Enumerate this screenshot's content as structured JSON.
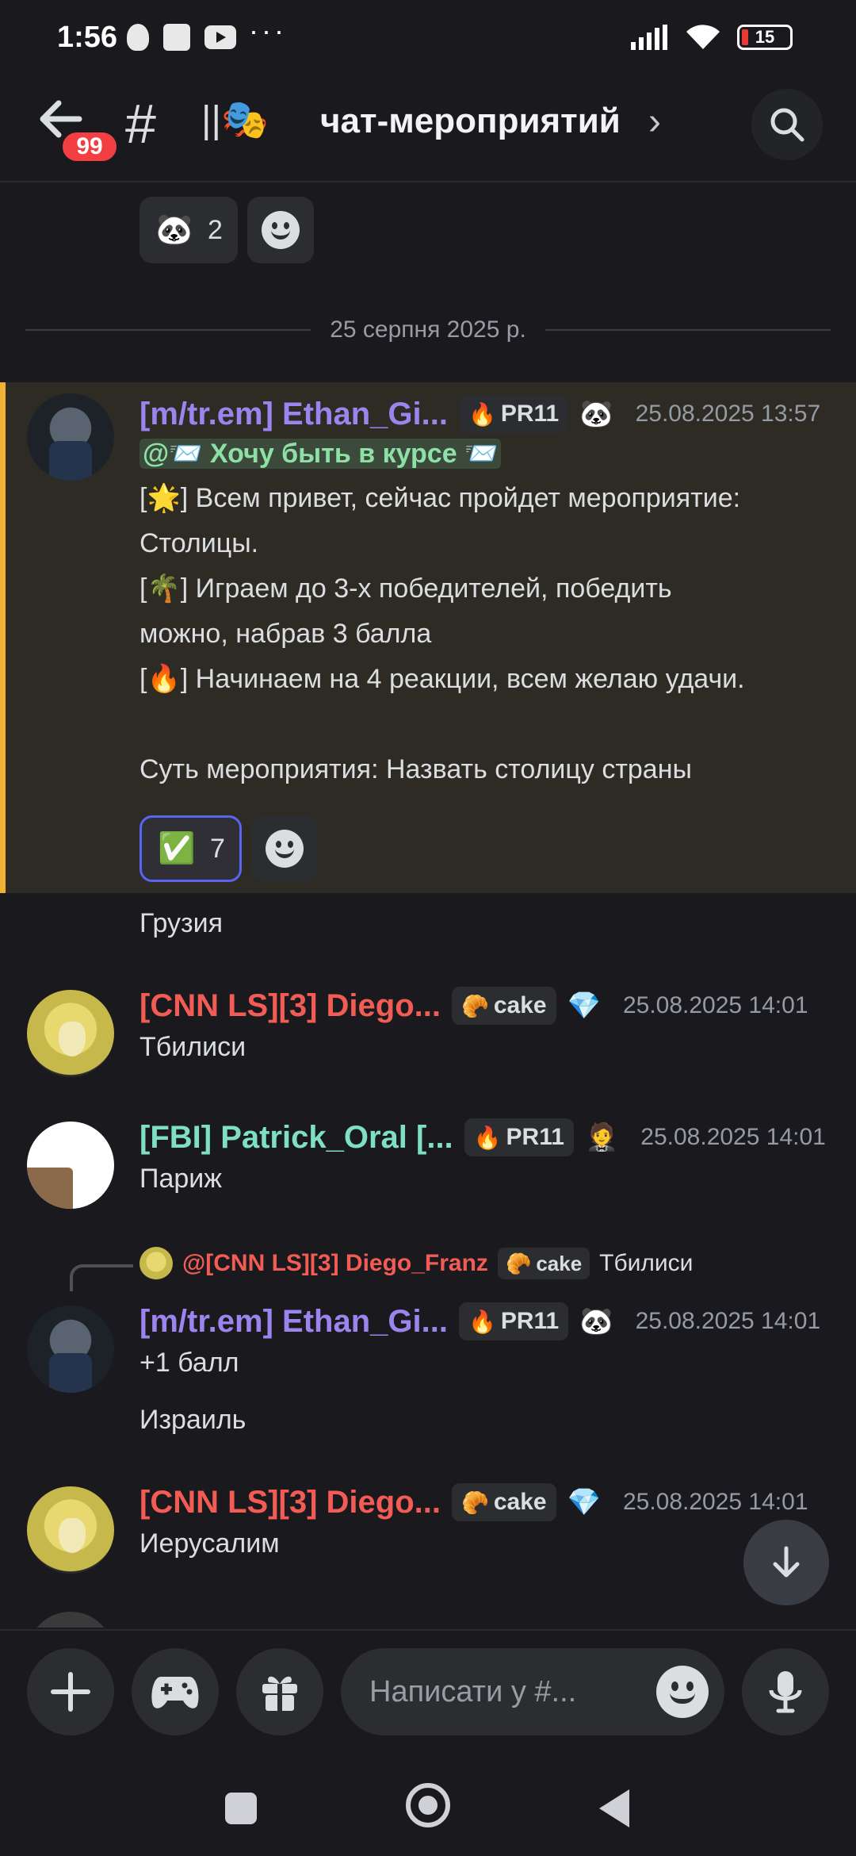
{
  "status": {
    "time": "1:56",
    "dots": "···",
    "battery": "15"
  },
  "header": {
    "unread_badge": "99",
    "channel_prefix": "||🎭",
    "channel_name": "чат-мероприятий",
    "chevron": "›"
  },
  "top_reaction": {
    "emoji": "🐼",
    "count": "2"
  },
  "date_divider": "25 серпня 2025 р.",
  "messages": {
    "m1": {
      "username": "[m/tr.em] Ethan_Gi...",
      "role_tag": "PR11",
      "role_tag_icon": "🔥",
      "role_icon": "🐼",
      "timestamp": "25.08.2025 13:57",
      "mention": "@📨 Хочу быть в курсе 📨",
      "line1": "[🌟] Всем привет, сейчас пройдет мероприятие:",
      "line2": "Столицы.",
      "line3": "[🌴] Играем до 3-х победителей, победить",
      "line4": "можно, набрав 3 балла",
      "line5": "[🔥] Начинаем на 4 реакции, всем желаю удачи.",
      "line6": "Суть мероприятия: Назвать столицу страны",
      "reaction_emoji": "✅",
      "reaction_count": "7",
      "followup": "Грузия"
    },
    "m2": {
      "username": "[CNN LS][3] Diego...",
      "role_tag": "cake",
      "role_tag_icon": "🥐",
      "role_icon": "💎",
      "timestamp": "25.08.2025 14:01",
      "text": "Тбилиси"
    },
    "m3": {
      "username": "[FBI] Patrick_Oral [...",
      "role_tag": "PR11",
      "role_tag_icon": "🔥",
      "role_icon": "🤵",
      "timestamp": "25.08.2025 14:01",
      "text": "Париж"
    },
    "m4": {
      "reply_user": "@[CNN LS][3] Diego_Franz",
      "reply_role": "cake",
      "reply_role_icon": "🥐",
      "reply_text": "Тбилиси",
      "username": "[m/tr.em] Ethan_Gi...",
      "role_tag": "PR11",
      "role_tag_icon": "🔥",
      "role_icon": "🐼",
      "timestamp": "25.08.2025 14:01",
      "text": "+1 балл",
      "followup": "Израиль"
    },
    "m5": {
      "username": "[CNN LS][3] Diego...",
      "role_tag": "cake",
      "role_tag_icon": "🥐",
      "role_icon": "💎",
      "timestamp": "25.08.2025 14:01",
      "text": "Иерусалим"
    }
  },
  "composer": {
    "placeholder": "Написати у #..."
  }
}
